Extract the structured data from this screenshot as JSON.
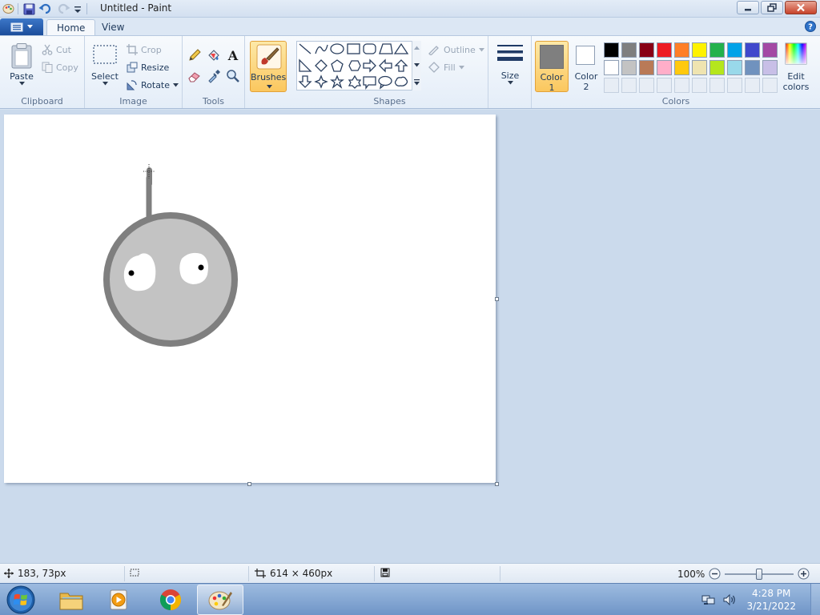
{
  "window": {
    "title": "Untitled - Paint"
  },
  "tabs": [
    {
      "label": "Home",
      "active": true
    },
    {
      "label": "View",
      "active": false
    }
  ],
  "ribbon": {
    "clipboard": {
      "label": "Clipboard",
      "paste": "Paste",
      "cut": "Cut",
      "copy": "Copy"
    },
    "image": {
      "label": "Image",
      "select": "Select",
      "crop": "Crop",
      "resize": "Resize",
      "rotate": "Rotate"
    },
    "tools": {
      "label": "Tools"
    },
    "brushes": {
      "label": "Brushes"
    },
    "shapes": {
      "label": "Shapes",
      "outline": "Outline",
      "fill": "Fill"
    },
    "size": {
      "label": "Size"
    },
    "colors": {
      "label": "Colors",
      "color1_line1": "Color",
      "color1_line2": "1",
      "color2_line1": "Color",
      "color2_line2": "2",
      "edit_line1": "Edit",
      "edit_line2": "colors",
      "color1_value": "#7f7f7f",
      "color2_value": "#ffffff",
      "palette_row1": [
        "#000000",
        "#7f7f7f",
        "#880015",
        "#ed1c24",
        "#ff7f27",
        "#fff200",
        "#22b14c",
        "#00a2e8",
        "#3f48cc",
        "#a349a4"
      ],
      "palette_row2": [
        "#ffffff",
        "#c3c3c3",
        "#b97a57",
        "#ffaec9",
        "#ffc90e",
        "#efe4b0",
        "#b5e61d",
        "#99d9ea",
        "#7092be",
        "#c8bfe7"
      ]
    }
  },
  "statusbar": {
    "cursor_position": "183, 73px",
    "canvas_size": "614 × 460px",
    "zoom": "100%",
    "zoom_level": 1.0
  },
  "taskbar": {
    "time": "4:28 PM",
    "date": "3/21/2022"
  }
}
